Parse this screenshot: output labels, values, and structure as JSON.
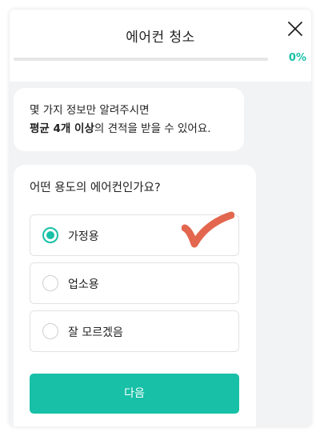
{
  "header": {
    "title": "에어컨 청소",
    "close_icon": "close-icon",
    "progress_text": "0%",
    "progress_fraction": 0.0,
    "accent_color": "#17c0a6"
  },
  "info": {
    "line1": "몇 가지 정보만 알려주시면",
    "line2_bold": "평균 4개 이상",
    "line2_rest": "의 견적을 받을 수 있어요."
  },
  "question": {
    "text": "어떤 용도의 에어컨인가요?",
    "options": [
      {
        "label": "가정용",
        "selected": true
      },
      {
        "label": "업소용",
        "selected": false
      },
      {
        "label": "잘 모르겠음",
        "selected": false
      }
    ]
  },
  "actions": {
    "next_label": "다음"
  },
  "annotation": {
    "mark": "checkmark-icon",
    "color": "#e0573c"
  }
}
